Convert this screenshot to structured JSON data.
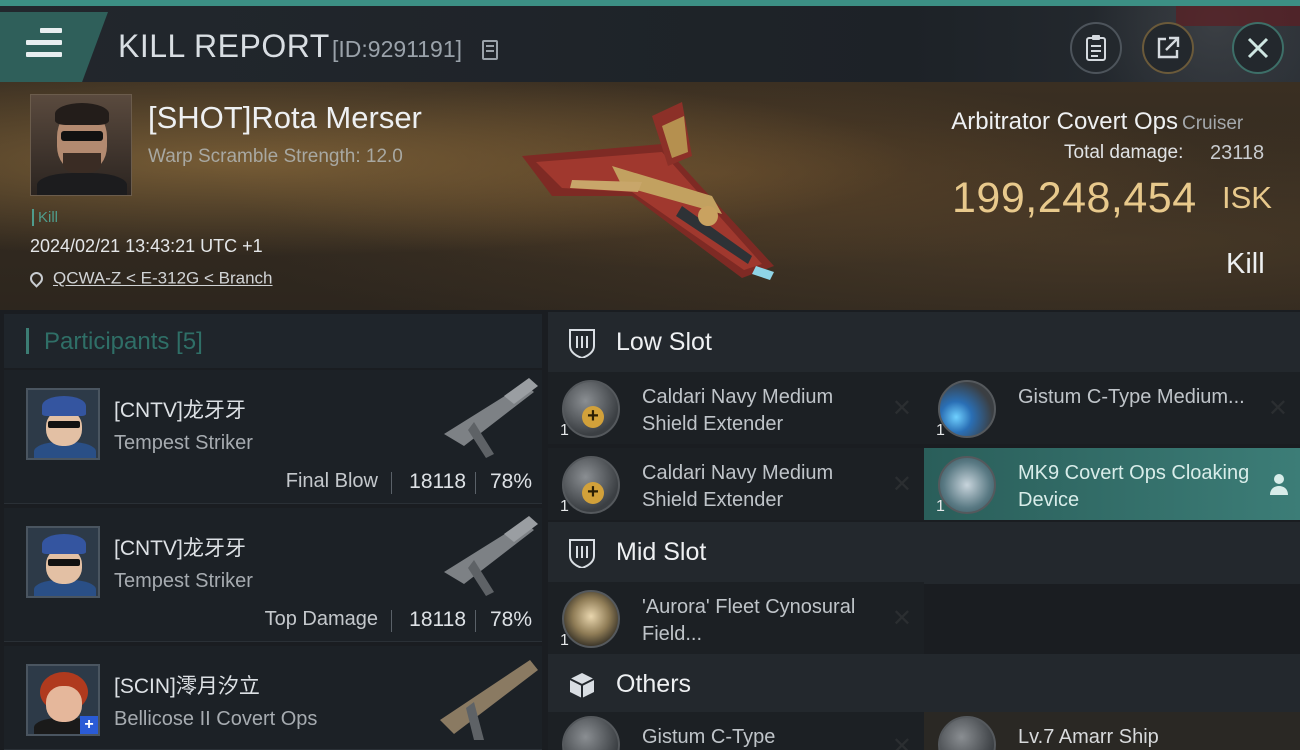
{
  "header": {
    "title": "KILL REPORT",
    "report_id": "[ID:9291191]"
  },
  "victim": {
    "name": "[SHOT]Rota Merser",
    "warp_scramble": "Warp Scramble Strength: 12.0",
    "kill_tag": "Kill",
    "datetime": "2024/02/21 13:43:21 UTC +1",
    "location": "QCWA-Z < E-312G < Branch",
    "ship_name": "Arbitrator Covert Ops",
    "ship_class": "Cruiser",
    "damage_label": "Total damage:",
    "damage_value": "23118",
    "isk_value": "199,248,454",
    "isk_unit": "ISK",
    "status": "Kill"
  },
  "participants": {
    "header": "Participants [5]",
    "rows": [
      {
        "name": "[CNTV]龙牙牙",
        "ship": "Tempest Striker",
        "role": "Final Blow",
        "damage": "18118",
        "percent": "78%"
      },
      {
        "name": "[CNTV]龙牙牙",
        "ship": "Tempest Striker",
        "role": "Top Damage",
        "damage": "18118",
        "percent": "78%"
      },
      {
        "name": "[SCIN]澪月汐立",
        "ship": "Bellicose II Covert Ops",
        "role": "",
        "damage": "",
        "percent": ""
      }
    ]
  },
  "slots": {
    "low": {
      "label": "Low Slot",
      "items": [
        {
          "qty": "1",
          "name": "Caldari Navy Medium Shield Extender"
        },
        {
          "qty": "1",
          "name": "Gistum C-Type Medium..."
        },
        {
          "qty": "1",
          "name": "Caldari Navy Medium Shield Extender"
        },
        {
          "qty": "1",
          "name": "MK9 Covert Ops Cloaking Device"
        }
      ]
    },
    "mid": {
      "label": "Mid Slot",
      "items": [
        {
          "qty": "1",
          "name": "'Aurora' Fleet Cynosural Field..."
        }
      ]
    },
    "others": {
      "label": "Others",
      "items": [
        {
          "qty": "",
          "name": "Gistum C-Type"
        },
        {
          "qty": "",
          "name": "Lv.7 Amarr Ship"
        }
      ]
    }
  },
  "icons": [
    "menu-icon",
    "copy-icon",
    "report-icon",
    "share-icon",
    "close-icon",
    "pin-icon",
    "shield-slot-icon",
    "box-icon",
    "remove-icon",
    "user-icon"
  ],
  "colors": {
    "accent": "#3c8f84",
    "isk": "#e8c98c"
  }
}
